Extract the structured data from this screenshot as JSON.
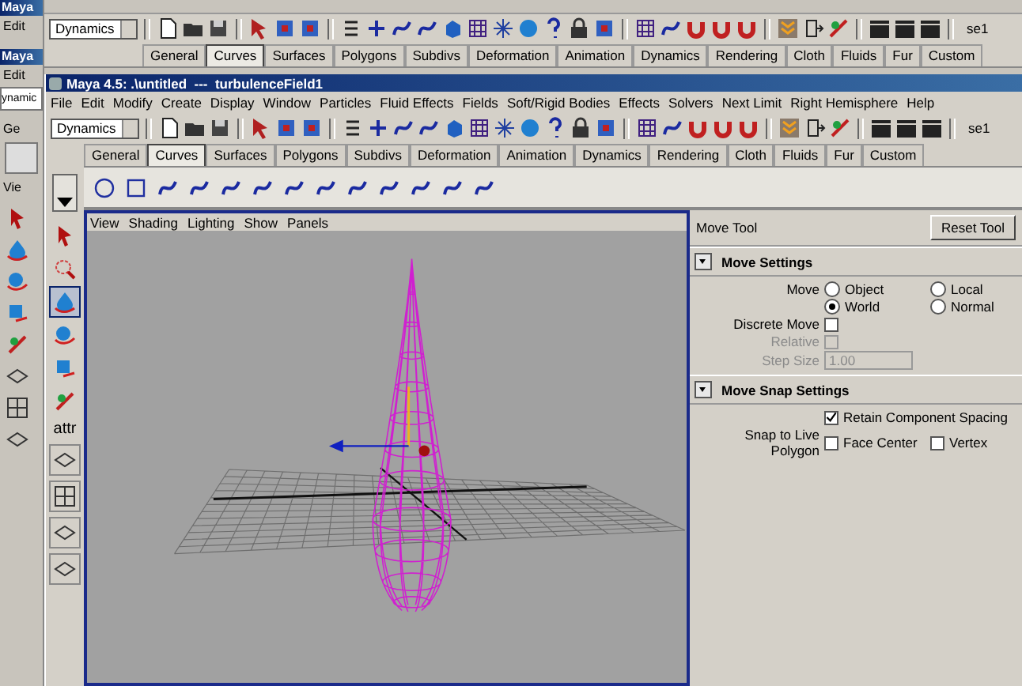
{
  "background_window": {
    "title": "Maya",
    "menu_item": "Edit",
    "menu_set": "Dynamics",
    "selection_field": "se1",
    "shelf_tabs": [
      {
        "label": "General",
        "selected": false
      },
      {
        "label": "Curves",
        "selected": true
      },
      {
        "label": "Surfaces",
        "selected": false
      },
      {
        "label": "Polygons",
        "selected": false
      },
      {
        "label": "Subdivs",
        "selected": false
      },
      {
        "label": "Deformation",
        "selected": false
      },
      {
        "label": "Animation",
        "selected": false
      },
      {
        "label": "Dynamics",
        "selected": false
      },
      {
        "label": "Rendering",
        "selected": false
      },
      {
        "label": "Cloth",
        "selected": false
      },
      {
        "label": "Fluids",
        "selected": false
      },
      {
        "label": "Fur",
        "selected": false
      },
      {
        "label": "Custom",
        "selected": false
      }
    ]
  },
  "second_background_window": {
    "title": "Maya",
    "menu_item": "Edit",
    "menu_set": "ynamic",
    "shelf_tab": "Ge",
    "panel_menu": "Vie"
  },
  "window": {
    "title": "Maya 4.5: .\\untitled  ---  turbulenceField1"
  },
  "menu_bar": [
    "File",
    "Edit",
    "Modify",
    "Create",
    "Display",
    "Window",
    "Particles",
    "Fluid Effects",
    "Fields",
    "Soft/Rigid Bodies",
    "Effects",
    "Solvers",
    "Next Limit",
    "Right Hemisphere",
    "Help"
  ],
  "status_line": {
    "menu_set": "Dynamics",
    "selection_field": "se1"
  },
  "shelf_tabs": [
    {
      "label": "General",
      "selected": false
    },
    {
      "label": "Curves",
      "selected": true
    },
    {
      "label": "Surfaces",
      "selected": false
    },
    {
      "label": "Polygons",
      "selected": false
    },
    {
      "label": "Subdivs",
      "selected": false
    },
    {
      "label": "Deformation",
      "selected": false
    },
    {
      "label": "Animation",
      "selected": false
    },
    {
      "label": "Dynamics",
      "selected": false
    },
    {
      "label": "Rendering",
      "selected": false
    },
    {
      "label": "Cloth",
      "selected": false
    },
    {
      "label": "Fluids",
      "selected": false
    },
    {
      "label": "Fur",
      "selected": false
    },
    {
      "label": "Custom",
      "selected": false
    }
  ],
  "tool_box": {
    "attr_label": "attr"
  },
  "viewport": {
    "menu": [
      "View",
      "Shading",
      "Lighting",
      "Show",
      "Panels"
    ]
  },
  "tool_settings": {
    "title": "Move Tool",
    "reset_button": "Reset Tool",
    "move_settings": {
      "title": "Move Settings",
      "expanded": true,
      "move_label": "Move",
      "move_options": [
        {
          "label": "Object",
          "selected": false
        },
        {
          "label": "Local",
          "selected": false
        },
        {
          "label": "World",
          "selected": true
        },
        {
          "label": "Normal",
          "selected": false
        }
      ],
      "discrete_move": {
        "label": "Discrete Move",
        "checked": false
      },
      "relative": {
        "label": "Relative",
        "checked": false,
        "disabled": true
      },
      "step_size": {
        "label": "Step Size",
        "value": "1.00",
        "disabled": true
      }
    },
    "snap_settings": {
      "title": "Move Snap Settings",
      "expanded": true,
      "retain_spacing": {
        "label": "Retain Component Spacing",
        "checked": true
      },
      "snap_label": "Snap to Live Polygon",
      "snap_options": [
        {
          "label": "Face Center",
          "checked": false
        },
        {
          "label": "Vertex",
          "checked": false
        }
      ]
    }
  }
}
